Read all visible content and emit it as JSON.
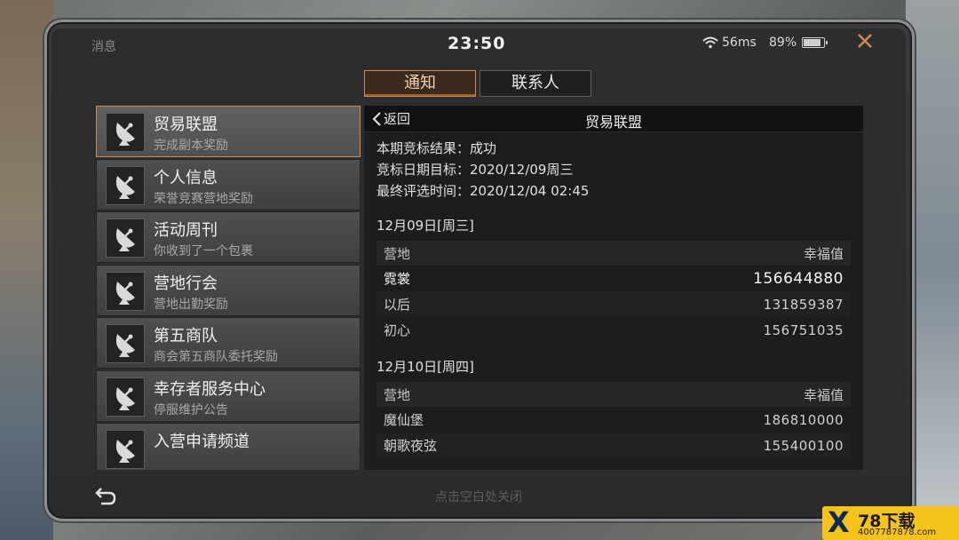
{
  "status": {
    "title": "消息",
    "time": "23:50",
    "ping": "56ms",
    "battery": "89%"
  },
  "tabs": [
    {
      "label": "通知",
      "active": true
    },
    {
      "label": "联系人",
      "active": false
    }
  ],
  "sidebar": {
    "items": [
      {
        "title": "贸易联盟",
        "subtitle": "完成副本奖励",
        "active": true
      },
      {
        "title": "个人信息",
        "subtitle": "荣誉竞赛营地奖励"
      },
      {
        "title": "活动周刊",
        "subtitle": "你收到了一个包裹"
      },
      {
        "title": "营地行会",
        "subtitle": "营地出勤奖励"
      },
      {
        "title": "第五商队",
        "subtitle": "商会第五商队委托奖励"
      },
      {
        "title": "幸存者服务中心",
        "subtitle": "停服维护公告"
      },
      {
        "title": "入营申请频道",
        "subtitle": ""
      }
    ]
  },
  "content": {
    "back_label": "返回",
    "title": "贸易联盟",
    "info": [
      "本期竞标结果：成功",
      "竞标日期目标：2020/12/09周三",
      "最终评选时间：2020/12/04 02:45"
    ],
    "sections": [
      {
        "date": "12月09日[周三]",
        "header": {
          "left": "营地",
          "right": "幸福值"
        },
        "rows": [
          {
            "name": "霓裳",
            "value": "156644880"
          },
          {
            "name": "以后",
            "value": "131859387"
          },
          {
            "name": "初心",
            "value": "156751035"
          }
        ]
      },
      {
        "date": "12月10日[周四]",
        "header": {
          "left": "营地",
          "right": "幸福值"
        },
        "rows": [
          {
            "name": "魔仙堡",
            "value": "186810000"
          },
          {
            "name": "朝歌夜弦",
            "value": "155400100"
          }
        ]
      }
    ]
  },
  "bottom": {
    "hint": "点击空白处关闭"
  },
  "watermark": {
    "x": "X",
    "brand": "78下载",
    "url": "4007787878.com"
  },
  "colors": {
    "accent": "#d68a4d",
    "panel_bg": "#1c1d1e"
  }
}
